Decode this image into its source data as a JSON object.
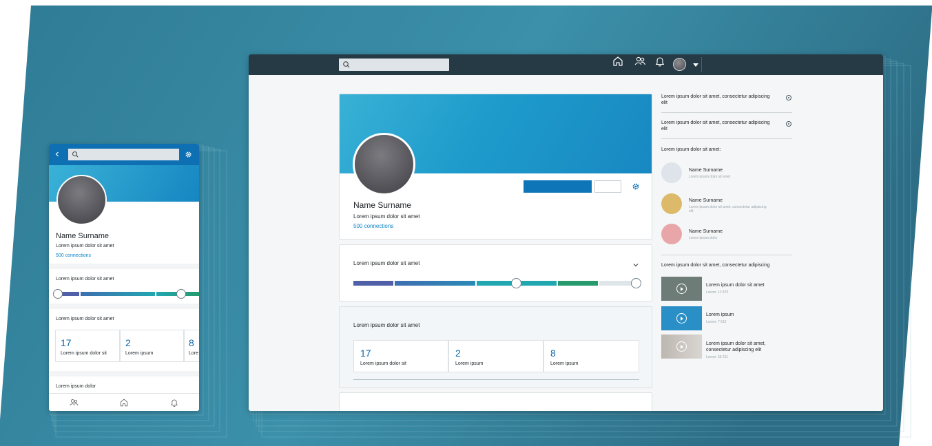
{
  "colors": {
    "topbar": "#263a46",
    "accent": "#0e75b8",
    "link": "#0a84c6",
    "banner_start": "#39b1d6",
    "banner_end": "#1888c2"
  },
  "desktop": {
    "topbar": {
      "icons": [
        "home-icon",
        "people-icon",
        "bell-icon",
        "avatar",
        "caret-down-icon"
      ]
    },
    "profile": {
      "name": "Name Surname",
      "subtitle": "Lorem ipsum dolor sit amet",
      "connections": "500 connections"
    },
    "progress_card": {
      "title": "Lorem ipsum dolor sit amet",
      "progress": 0.57
    },
    "stats_card": {
      "title": "Lorem ipsum dolor sit amet",
      "stats": [
        {
          "value": "17",
          "label": "Lorem ipsum dolor sit"
        },
        {
          "value": "2",
          "label": "Lorem ipsum"
        },
        {
          "value": "8",
          "label": "Lorem ipsum"
        }
      ]
    },
    "sidebar": {
      "options": [
        "Lorem ipsum dolor sit amet, consectetur adipiscing elit",
        "Lorem ipsum dolor sit amet, consectetur adipiscing elit"
      ],
      "people_title": "Lorem ipsum dolor sit amet:",
      "people": [
        {
          "name": "Name Surname",
          "desc": "Lorem ipsum dolor sit amet",
          "color": "#dfe3ea"
        },
        {
          "name": "Name Surname",
          "desc": "Lorem ipsum dolor sit amet, consectetur adipiscing elit",
          "color": "#ddb96a"
        },
        {
          "name": "Name Surname",
          "desc": "Lorem ipsum dolor",
          "color": "#e9a6a8"
        }
      ],
      "videos_title": "Lorem ipsum dolor sit amet, consectetur adipiscing",
      "videos": [
        {
          "title": "Lorem ipsum dolor sit amet",
          "meta": "Lorem: 12 875",
          "color": "#6d7c76"
        },
        {
          "title": "Lorem ipsum",
          "meta": "Lorem: 7 612",
          "color": "#2a8fc7"
        },
        {
          "title": "Lorem ipsum dolor sit amet, consectetur adipiscing elit",
          "meta": "Lorem: 55 211",
          "color": "#cfcac4"
        }
      ]
    }
  },
  "mobile": {
    "profile": {
      "name": "Name Surname",
      "subtitle": "Lorem ipsum dolor sit amet",
      "connections": "500 connections"
    },
    "progress_title": "Lorem ipsum dolor sit amet",
    "progress": 0.85,
    "stats_title": "Lorem ipsum dolor sit amet",
    "stats": [
      {
        "value": "17",
        "label": "Lorem ipsum dolor sit"
      },
      {
        "value": "2",
        "label": "Lorem ipsum"
      },
      {
        "value": "8",
        "label": "Lore"
      }
    ],
    "bottom_title": "Lorem ipsum dolor",
    "nav_icons": [
      "people-icon",
      "home-icon",
      "bell-icon"
    ]
  }
}
